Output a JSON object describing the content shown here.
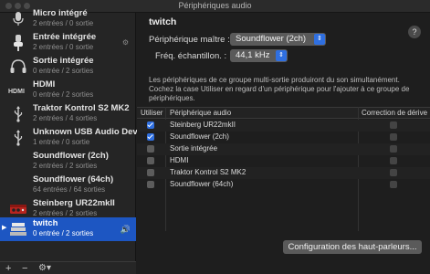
{
  "window": {
    "title": "Périphériques audio"
  },
  "sidebar": {
    "devices": [
      {
        "name": "Micro intégré",
        "sub": "2 entrées / 0 sortie",
        "icon": "microphone-icon"
      },
      {
        "name": "Entrée intégrée",
        "sub": "2 entrées / 0 sortie",
        "icon": "line-in-icon"
      },
      {
        "name": "Sortie intégrée",
        "sub": "0 entrée / 2 sorties",
        "icon": "headphones-icon"
      },
      {
        "name": "HDMI",
        "sub": "0 entrée / 2 sorties",
        "icon": "hdmi-icon"
      },
      {
        "name": "Traktor Kontrol S2 MK2",
        "sub": "2 entrées / 4 sorties",
        "icon": "usb-icon"
      },
      {
        "name": "Unknown USB Audio Devi...",
        "sub": "1 entrée / 0 sortie",
        "icon": "usb-icon"
      },
      {
        "name": "Soundflower (2ch)",
        "sub": "2 entrées / 2 sorties",
        "icon": "blank"
      },
      {
        "name": "Soundflower (64ch)",
        "sub": "64 entrées / 64 sorties",
        "icon": "blank"
      },
      {
        "name": "Steinberg UR22mkII",
        "sub": "2 entrées / 2 sorties",
        "icon": "interface-icon"
      },
      {
        "name": "twitch",
        "sub": "0 entrée / 2 sorties",
        "icon": "multi-output-icon",
        "selected": true
      }
    ],
    "bottom": {
      "add": "+",
      "remove": "−",
      "gear": "⚙▾"
    }
  },
  "main": {
    "device_title": "twitch",
    "master_label": "Périphérique maître :",
    "master_value": "Soundflower (2ch)",
    "rate_label": "Fréq. échantillon. :",
    "rate_value": "44,1 kHz",
    "description": "Les périphériques de ce groupe multi-sortie produiront du son simultanément. Cochez la case Utiliser en regard d'un périphérique pour l'ajouter à ce groupe de périphériques.",
    "table": {
      "headers": {
        "use": "Utiliser",
        "device": "Périphérique audio",
        "drift": "Correction de dérive"
      },
      "rows": [
        {
          "name": "Steinberg UR22mkII",
          "checked": true
        },
        {
          "name": "Soundflower (2ch)",
          "checked": true
        },
        {
          "name": "Sortie intégrée",
          "checked": false
        },
        {
          "name": "HDMI",
          "checked": false
        },
        {
          "name": "Traktor Kontrol S2 MK2",
          "checked": false
        },
        {
          "name": "Soundflower (64ch)",
          "checked": false
        }
      ]
    },
    "config_button": "Configuration des haut-parleurs...",
    "help": "?"
  },
  "colors": {
    "selection": "#1d56c2",
    "accent": "#2f6fe0"
  }
}
